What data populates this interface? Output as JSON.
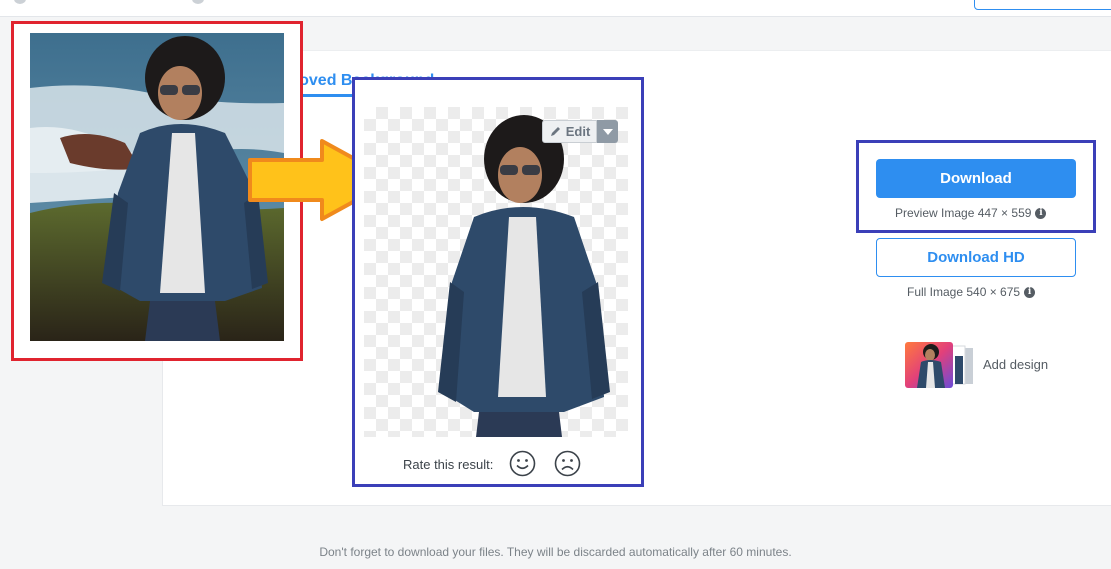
{
  "tabs": {
    "active_label": "emoved Background"
  },
  "result": {
    "edit_label": "Edit",
    "rate_label": "Rate this result:"
  },
  "downloads": {
    "download_label": "Download",
    "preview_text": "Preview Image 447 × 559",
    "download_hd_label": "Download HD",
    "full_text": "Full Image 540 × 675"
  },
  "design": {
    "add_label": "Add design"
  },
  "footer": {
    "notice": "Don't forget to download your files. They will be discarded automatically after 60 minutes."
  },
  "colors": {
    "accent": "#2e8ef0",
    "original_highlight": "#e0242f",
    "result_highlight": "#3b3fb8",
    "arrow_fill": "#ffc21a",
    "arrow_stroke": "#f08a1c"
  },
  "icons": [
    "pencil-icon",
    "caret-down-icon",
    "info-icon",
    "smile-icon",
    "frown-icon",
    "right-arrow"
  ]
}
